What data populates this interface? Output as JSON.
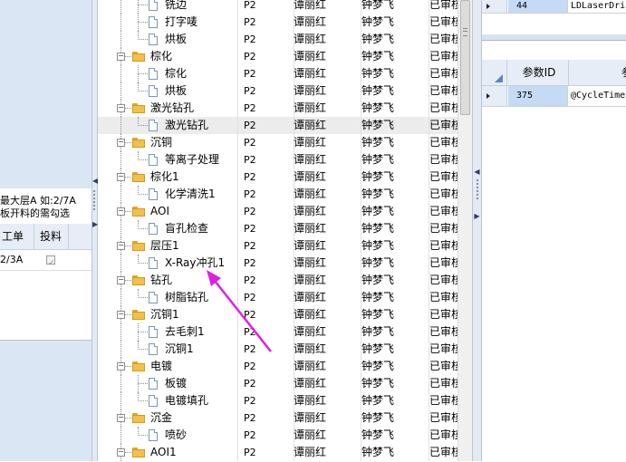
{
  "left_panel": {
    "hint_line1": "最大层A 如:2/7A",
    "hint_line2": "板开料的需勾选",
    "columns": [
      "工单",
      "投料"
    ],
    "row": {
      "work_order": "2/3A",
      "checked": true
    }
  },
  "tree": {
    "rows": [
      {
        "level": 1,
        "name": "铣边",
        "ver": "P2",
        "p1": "谭丽红",
        "p2": "钟梦飞",
        "status": "已审核"
      },
      {
        "level": 1,
        "name": "打字唛",
        "ver": "P2",
        "p1": "谭丽红",
        "p2": "钟梦飞",
        "status": "已审核"
      },
      {
        "level": 1,
        "name": "烘板",
        "ver": "P2",
        "p1": "谭丽红",
        "p2": "钟梦飞",
        "status": "已审核"
      },
      {
        "level": 0,
        "name": "棕化",
        "ver": "P2",
        "p1": "谭丽红",
        "p2": "钟梦飞",
        "status": "已审核"
      },
      {
        "level": 1,
        "name": "棕化",
        "ver": "P2",
        "p1": "谭丽红",
        "p2": "钟梦飞",
        "status": "已审核"
      },
      {
        "level": 1,
        "name": "烘板",
        "ver": "P2",
        "p1": "谭丽红",
        "p2": "钟梦飞",
        "status": "已审核"
      },
      {
        "level": 0,
        "name": "激光钻孔",
        "ver": "P2",
        "p1": "谭丽红",
        "p2": "钟梦飞",
        "status": "已审核"
      },
      {
        "level": 1,
        "name": "激光钻孔",
        "ver": "P2",
        "p1": "谭丽红",
        "p2": "钟梦飞",
        "status": "已审核",
        "selected": true
      },
      {
        "level": 0,
        "name": "沉铜",
        "ver": "P2",
        "p1": "谭丽红",
        "p2": "钟梦飞",
        "status": "已审核"
      },
      {
        "level": 1,
        "name": "等离子处理",
        "ver": "P2",
        "p1": "谭丽红",
        "p2": "钟梦飞",
        "status": "已审核"
      },
      {
        "level": 0,
        "name": "棕化1",
        "ver": "P2",
        "p1": "谭丽红",
        "p2": "钟梦飞",
        "status": "已审核"
      },
      {
        "level": 1,
        "name": "化学清洗1",
        "ver": "P2",
        "p1": "谭丽红",
        "p2": "钟梦飞",
        "status": "已审核"
      },
      {
        "level": 0,
        "name": "AOI",
        "ver": "P2",
        "p1": "谭丽红",
        "p2": "钟梦飞",
        "status": "已审核"
      },
      {
        "level": 1,
        "name": "盲孔检查",
        "ver": "P2",
        "p1": "谭丽红",
        "p2": "钟梦飞",
        "status": "已审核"
      },
      {
        "level": 0,
        "name": "层压1",
        "ver": "P2",
        "p1": "谭丽红",
        "p2": "钟梦飞",
        "status": "已审核"
      },
      {
        "level": 1,
        "name": "X-Ray冲孔1",
        "ver": "P2",
        "p1": "谭丽红",
        "p2": "钟梦飞",
        "status": "已审核"
      },
      {
        "level": 0,
        "name": "钻孔",
        "ver": "P2",
        "p1": "谭丽红",
        "p2": "钟梦飞",
        "status": "已审核"
      },
      {
        "level": 1,
        "name": "树脂钻孔",
        "ver": "P2",
        "p1": "谭丽红",
        "p2": "钟梦飞",
        "status": "已审核"
      },
      {
        "level": 0,
        "name": "沉铜1",
        "ver": "P2",
        "p1": "谭丽红",
        "p2": "钟梦飞",
        "status": "已审核"
      },
      {
        "level": 1,
        "name": "去毛刺1",
        "ver": "P2",
        "p1": "谭丽红",
        "p2": "钟梦飞",
        "status": "已审核"
      },
      {
        "level": 1,
        "name": "沉铜1",
        "ver": "P2",
        "p1": "谭丽红",
        "p2": "钟梦飞",
        "status": "已审核"
      },
      {
        "level": 0,
        "name": "电镀",
        "ver": "P2",
        "p1": "谭丽红",
        "p2": "钟梦飞",
        "status": "已审核"
      },
      {
        "level": 1,
        "name": "板镀",
        "ver": "P2",
        "p1": "谭丽红",
        "p2": "钟梦飞",
        "status": "已审核"
      },
      {
        "level": 1,
        "name": "电镀填孔",
        "ver": "P2",
        "p1": "谭丽红",
        "p2": "钟梦飞",
        "status": "已审核"
      },
      {
        "level": 0,
        "name": "沉金",
        "ver": "P2",
        "p1": "谭丽红",
        "p2": "钟梦飞",
        "status": "已审核"
      },
      {
        "level": 1,
        "name": "喷砂",
        "ver": "P2",
        "p1": "谭丽红",
        "p2": "钟梦飞",
        "status": "已审核"
      },
      {
        "level": 0,
        "name": "AOI1",
        "ver": "P2",
        "p1": "谭丽红",
        "p2": "钟梦飞",
        "status": "已审核"
      }
    ]
  },
  "right_top": {
    "row": {
      "id": "44",
      "name": "LDLaserDri"
    }
  },
  "right_bottom": {
    "columns": [
      "参数ID",
      "参"
    ],
    "row": {
      "id": "375",
      "name": "@CycleTime"
    }
  },
  "colors": {
    "annotation_arrow": "#e020e0",
    "selected_row": "#ececec",
    "id_cell": "#c5daf4"
  }
}
